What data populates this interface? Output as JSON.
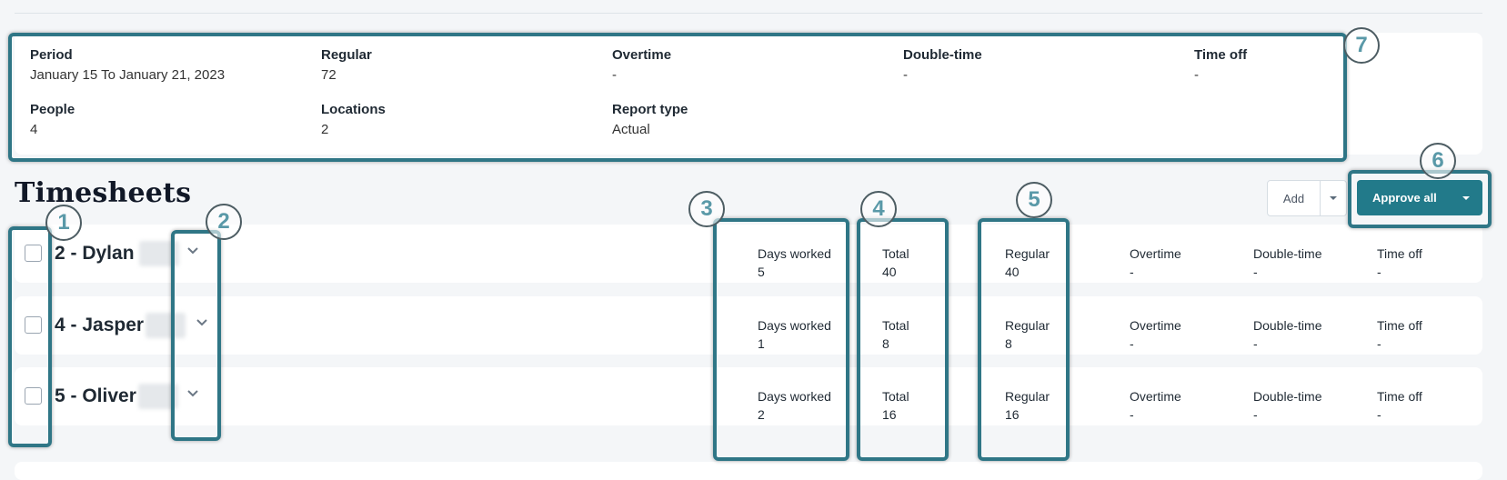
{
  "summary": {
    "period": {
      "label": "Period",
      "value": "January 15 To January 21, 2023"
    },
    "regular": {
      "label": "Regular",
      "value": "72"
    },
    "overtime": {
      "label": "Overtime",
      "value": "-"
    },
    "double_time": {
      "label": "Double-time",
      "value": "-"
    },
    "time_off": {
      "label": "Time off",
      "value": "-"
    },
    "people": {
      "label": "People",
      "value": "4"
    },
    "locations": {
      "label": "Locations",
      "value": "2"
    },
    "report_type": {
      "label": "Report type",
      "value": "Actual"
    }
  },
  "title": "Timesheets",
  "toolbar": {
    "add_label": "Add",
    "approve_label": "Approve all"
  },
  "rows": [
    {
      "name": "2 - Dylan",
      "days_label": "Days worked",
      "days": "5",
      "total_label": "Total",
      "total": "40",
      "regular_label": "Regular",
      "regular": "40",
      "overtime_label": "Overtime",
      "overtime": "-",
      "double_label": "Double-time",
      "double": "-",
      "timeoff_label": "Time off",
      "timeoff": "-"
    },
    {
      "name": "4 - Jasper",
      "days_label": "Days worked",
      "days": "1",
      "total_label": "Total",
      "total": "8",
      "regular_label": "Regular",
      "regular": "8",
      "overtime_label": "Overtime",
      "overtime": "-",
      "double_label": "Double-time",
      "double": "-",
      "timeoff_label": "Time off",
      "timeoff": "-"
    },
    {
      "name": "5 - Oliver",
      "days_label": "Days worked",
      "days": "2",
      "total_label": "Total",
      "total": "16",
      "regular_label": "Regular",
      "regular": "16",
      "overtime_label": "Overtime",
      "overtime": "-",
      "double_label": "Double-time",
      "double": "-",
      "timeoff_label": "Time off",
      "timeoff": "-"
    }
  ],
  "annotations": [
    "1",
    "2",
    "3",
    "4",
    "5",
    "6",
    "7"
  ],
  "colors": {
    "accent": "#227a8a",
    "annotation": "#2f7686"
  }
}
